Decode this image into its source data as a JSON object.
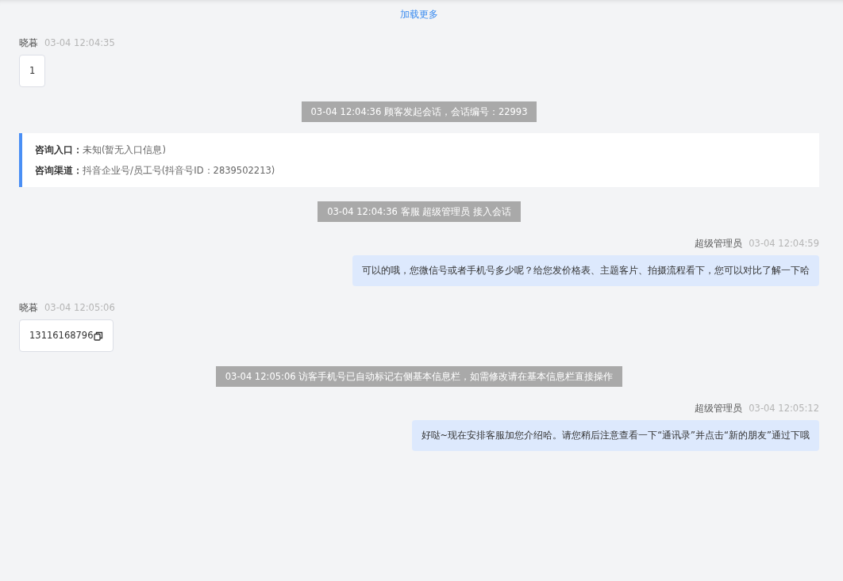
{
  "load_more": "加载更多",
  "items": [
    {
      "kind": "visitor_message",
      "sender": "晓暮",
      "time": "03-04 12:04:35",
      "text": "1",
      "copyable": false
    },
    {
      "kind": "system",
      "text": "03-04 12:04:36 顾客发起会话，会话编号：22993"
    },
    {
      "kind": "info",
      "rows": [
        {
          "label": "咨询入口：",
          "value": "未知(暂无入口信息)"
        },
        {
          "label": "咨询渠道：",
          "value": "抖音企业号/员工号(抖音号ID：2839502213)"
        }
      ]
    },
    {
      "kind": "system",
      "text": "03-04 12:04:36 客服 超级管理员 接入会话"
    },
    {
      "kind": "agent_message",
      "sender": "超级管理员",
      "time": "03-04 12:04:59",
      "text": "可以的哦，您微信号或者手机号多少呢？给您发价格表、主题客片、拍摄流程看下，您可以对比了解一下哈",
      "copyable": false
    },
    {
      "kind": "visitor_message",
      "sender": "晓暮",
      "time": "03-04 12:05:06",
      "text": "13116168796",
      "copyable": true
    },
    {
      "kind": "system",
      "text": "03-04 12:05:06 访客手机号已自动标记右侧基本信息栏，如需修改请在基本信息栏直接操作"
    },
    {
      "kind": "agent_message",
      "sender": "超级管理员",
      "time": "03-04 12:05:12",
      "text": "好哒~现在安排客服加您介绍哈。请您稍后注意查看一下“通讯录”并点击“新的朋友”通过下哦",
      "copyable": false
    }
  ]
}
